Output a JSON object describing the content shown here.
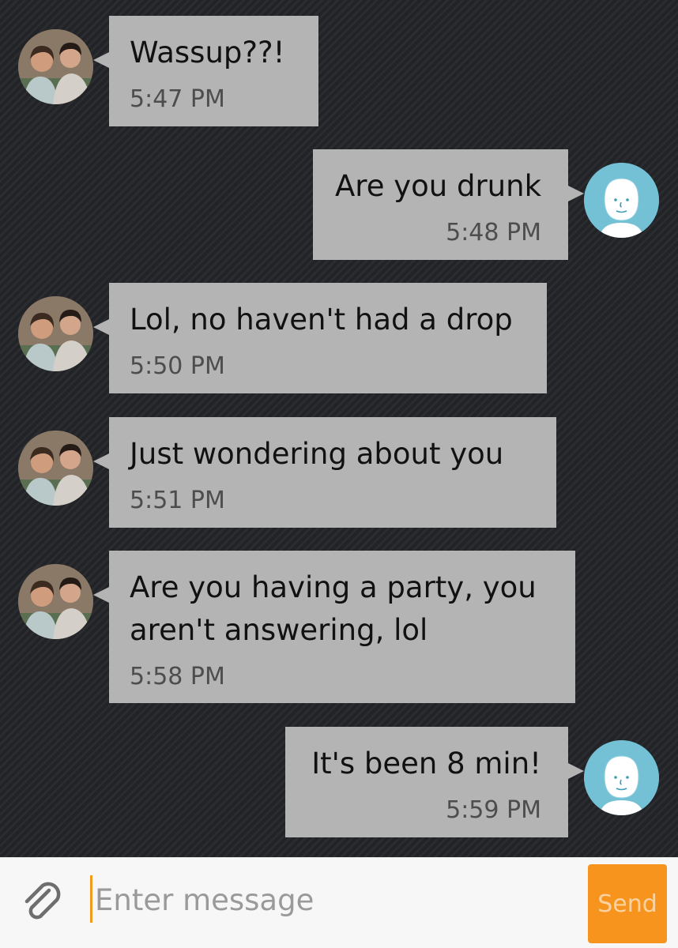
{
  "messages": [
    {
      "dir": "in",
      "text": "Wassup??!",
      "time": "5:47 PM"
    },
    {
      "dir": "out",
      "text": "Are you drunk",
      "time": "5:48 PM"
    },
    {
      "dir": "in",
      "text": "Lol, no haven't had a drop",
      "time": "5:50 PM"
    },
    {
      "dir": "in",
      "text": "Just wondering about you",
      "time": "5:51 PM"
    },
    {
      "dir": "in",
      "text": "Are you having a party, you\naren't answering, lol",
      "time": "5:58 PM"
    },
    {
      "dir": "out",
      "text": "It's been 8 min!",
      "time": "5:59 PM"
    }
  ],
  "composer": {
    "attach_icon": "paperclip-icon",
    "input_placeholder": "Enter message",
    "input_value": "",
    "send_label": "Send"
  },
  "colors": {
    "bubble": "#b4b4b4",
    "accent": "#f7941d",
    "my_avatar": "#74c1d6"
  }
}
